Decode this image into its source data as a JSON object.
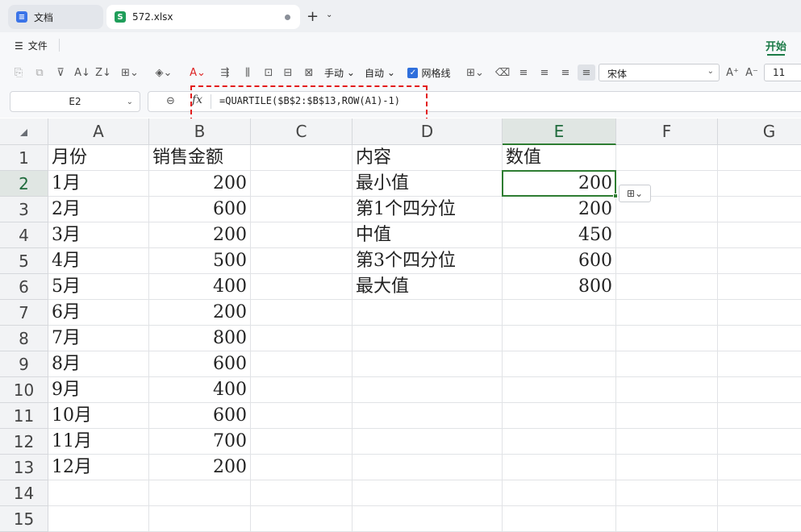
{
  "tabs": [
    {
      "label": "文档",
      "icon": "docs-icon",
      "color": "#3b74e8"
    },
    {
      "label": "572.xlsx",
      "icon": "sheet-icon",
      "color": "#1f9e5a"
    }
  ],
  "menu": {
    "file": "文件",
    "start": "开始"
  },
  "toolbar": {
    "manual": "手动",
    "auto": "自动",
    "gridlines": "网格线",
    "gridlines_checked": true,
    "font": "宋体",
    "size": "11"
  },
  "namebox": "E2",
  "formula": "=QUARTILE($B$2:$B$13,ROW(A1)-1)",
  "columns": [
    "A",
    "B",
    "C",
    "D",
    "E",
    "F",
    "G"
  ],
  "rows": [
    "1",
    "2",
    "3",
    "4",
    "5",
    "6",
    "7",
    "8",
    "9",
    "10",
    "11",
    "12",
    "13",
    "14",
    "15"
  ],
  "data": {
    "A": [
      "月份",
      "1月",
      "2月",
      "3月",
      "4月",
      "5月",
      "6月",
      "7月",
      "8月",
      "9月",
      "10月",
      "11月",
      "12月"
    ],
    "B": [
      "销售金额",
      "200",
      "600",
      "200",
      "500",
      "400",
      "200",
      "800",
      "600",
      "400",
      "600",
      "700",
      "200"
    ],
    "D": [
      "内容",
      "最小值",
      "第1个四分位",
      "中值",
      "第3个四分位",
      "最大值"
    ],
    "E": [
      "数值",
      "200",
      "200",
      "450",
      "600",
      "800"
    ]
  },
  "colors": {
    "accent": "#2e7d32",
    "highlight": "#e31b1b"
  }
}
